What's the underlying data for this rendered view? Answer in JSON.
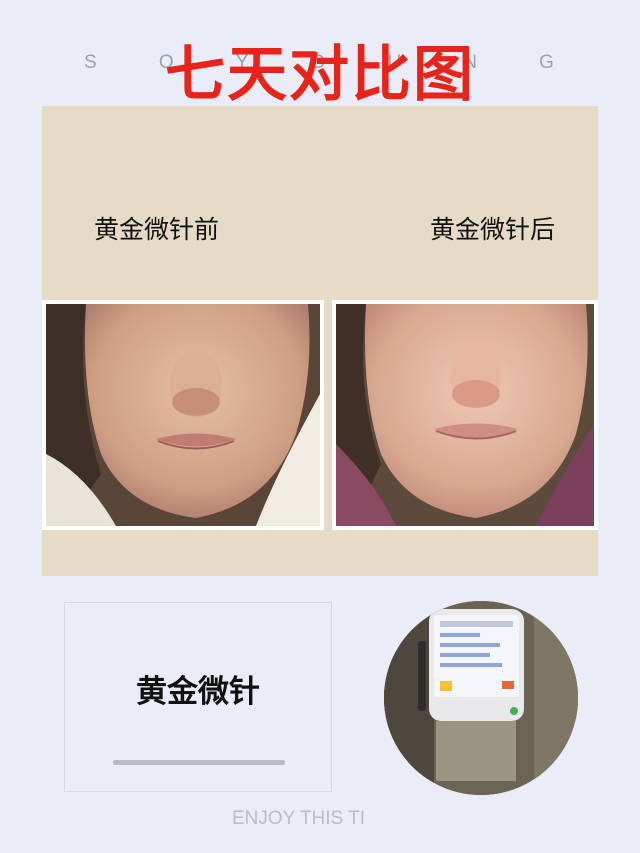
{
  "background_letters": [
    "S",
    "O",
    "Y",
    "O",
    "U",
    "N",
    "G"
  ],
  "title": "七天对比图",
  "labels": {
    "before": "黄金微针前",
    "after": "黄金微针后"
  },
  "photos": {
    "before": "before-face-photo",
    "after": "after-face-photo"
  },
  "card": {
    "title": "黄金微针"
  },
  "device_image": "golden-microneedle-device",
  "footer_text": "ENJOY THIS TI",
  "colors": {
    "title": "#e8241a",
    "panel": "#e6dcc6",
    "page_bg": "#eaedf7"
  }
}
